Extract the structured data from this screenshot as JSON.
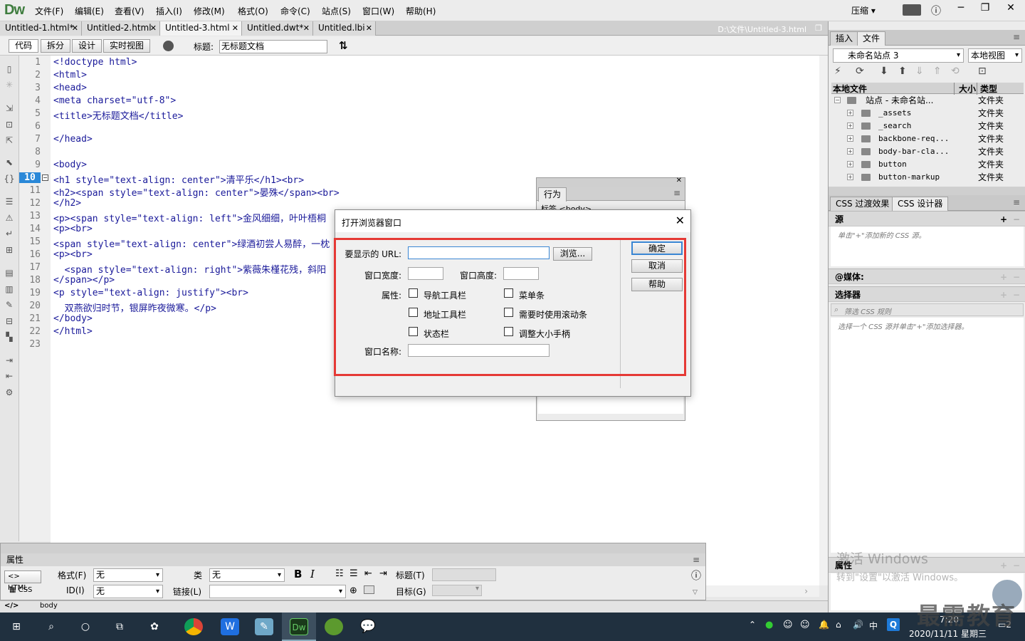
{
  "app": {
    "logo": "Dw",
    "workspace": "压缩"
  },
  "menu": [
    "文件(F)",
    "编辑(E)",
    "查看(V)",
    "插入(I)",
    "修改(M)",
    "格式(O)",
    "命令(C)",
    "站点(S)",
    "窗口(W)",
    "帮助(H)"
  ],
  "tabs": [
    {
      "label": "Untitled-1.html*"
    },
    {
      "label": "Untitled-2.html"
    },
    {
      "label": "Untitled-3.html"
    },
    {
      "label": "Untitled.dwt*"
    },
    {
      "label": "Untitled.lbi"
    }
  ],
  "doc_path": "D:\\文件\\Untitled-3.html",
  "toolbar": {
    "code": "代码",
    "split": "拆分",
    "design": "设计",
    "live": "实时视图",
    "title_label": "标题:",
    "title_value": "无标题文档"
  },
  "code": {
    "current_line": "10",
    "line_numbers": [
      "1",
      "2",
      "3",
      "4",
      "5",
      "6",
      "7",
      "8",
      "9",
      "10",
      "11",
      "12",
      "13",
      "14",
      "15",
      "16",
      "17",
      "18",
      "19",
      "20",
      "21",
      "22",
      "23"
    ],
    "lines": [
      "<!doctype html>",
      "<html>",
      "<head>",
      "<meta charset=\"utf-8\">",
      "<title>无标题文档</title>",
      "",
      "</head>",
      "",
      "<body>",
      "<h1 style=\"text-align: center\">清平乐</h1><br>",
      "<h2><span style=\"text-align: center\">晏殊</span><br>",
      "</h2>",
      "<p><span style=\"text-align: left\">金风细细，叶叶梧桐",
      "<p><br>",
      "<span style=\"text-align: center\">绿酒初尝人易醉，一枕",
      "<p><br>",
      "  <span style=\"text-align: right\">紫薇朱槿花残，斜阳",
      "</span></p>",
      "<p style=\"text-align: justify\"><br>",
      "  双燕欲归时节，银屏昨夜微寒。</p>",
      "</body>",
      "</html>",
      ""
    ]
  },
  "files_panel": {
    "tabs": [
      "插入",
      "文件"
    ],
    "site": "未命名站点 3",
    "view": "本地视图",
    "headers": {
      "local": "本地文件",
      "size": "大小",
      "type": "类型"
    },
    "root": {
      "name": "站点 - 未命名站...",
      "type": "文件夹"
    },
    "items": [
      {
        "name": "_assets",
        "type": "文件夹"
      },
      {
        "name": "_search",
        "type": "文件夹"
      },
      {
        "name": "backbone-req...",
        "type": "文件夹"
      },
      {
        "name": "body-bar-cla...",
        "type": "文件夹"
      },
      {
        "name": "button",
        "type": "文件夹"
      },
      {
        "name": "button-markup",
        "type": "文件夹"
      }
    ]
  },
  "css_panel": {
    "tabs": [
      "CSS 过渡效果",
      "CSS 设计器"
    ],
    "source_title": "源",
    "source_hint": "单击\"+\"添加新的 CSS 源。",
    "media_title": "@媒体:",
    "selector_title": "选择器",
    "filter_placeholder": "筛选 CSS 规则",
    "selector_hint": "选择一个 CSS 源并单击\"+\"添加选择器。",
    "props_title": "属性"
  },
  "behaviors": {
    "tab": "行为",
    "tag": "标签 <body>"
  },
  "dialog": {
    "title": "打开浏览器窗口",
    "url_label": "要显示的 URL:",
    "browse": "浏览...",
    "width_label": "窗口宽度:",
    "height_label": "窗口高度:",
    "attr_label": "属性:",
    "opts": [
      "导航工具栏",
      "菜单条",
      "地址工具栏",
      "需要时使用滚动条",
      "状态栏",
      "调整大小手柄"
    ],
    "name_label": "窗口名称:",
    "ok": "确定",
    "cancel": "取消",
    "help": "帮助"
  },
  "props": {
    "title": "属性",
    "html": "HTML",
    "css": "CSS",
    "format_label": "格式(F)",
    "format_value": "无",
    "class_label": "类",
    "class_value": "无",
    "id_label": "ID(I)",
    "id_value": "无",
    "link_label": "链接(L)",
    "title_label": "标题(T)",
    "target_label": "目标(G)"
  },
  "status": {
    "tag": "body"
  },
  "watermark": {
    "line1": "激活 Windows",
    "line2": "转到\"设置\"以激活 Windows。"
  },
  "brand": "最需教育",
  "taskbar": {
    "ime": "中",
    "time": "7:20",
    "date": "2020/11/11 星期三",
    "notifications": "2"
  },
  "colors": {
    "highlight": "#e53935",
    "accent": "#2a88d8",
    "taskbar": "#20303f"
  }
}
